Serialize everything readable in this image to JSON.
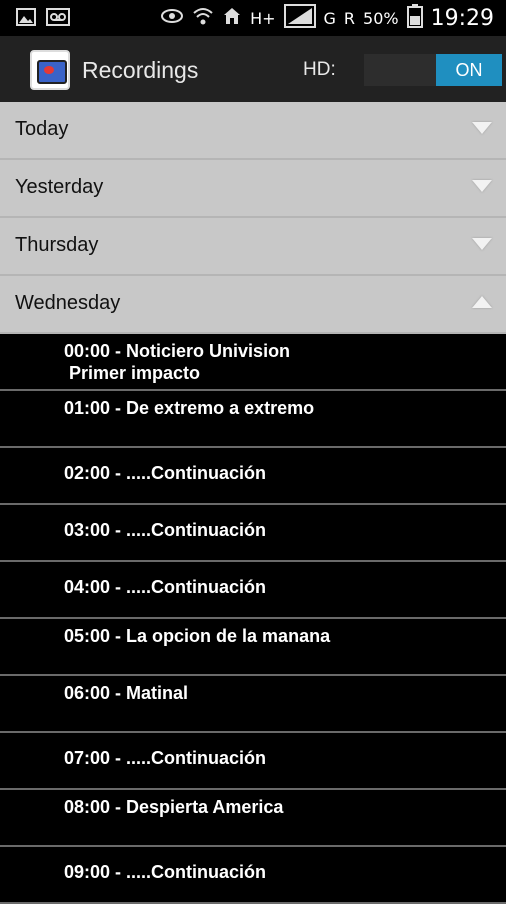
{
  "statusbar": {
    "network": "H+",
    "carrier": "G",
    "roaming": "R",
    "battery": "50%",
    "time": "19:29"
  },
  "actionbar": {
    "title": "Recordings",
    "hd_label": "HD:",
    "toggle_on": "ON"
  },
  "days": [
    {
      "label": "Today",
      "expanded": false
    },
    {
      "label": "Yesterday",
      "expanded": false
    },
    {
      "label": "Thursday",
      "expanded": false
    },
    {
      "label": "Wednesday",
      "expanded": true
    }
  ],
  "recordings": [
    {
      "text": "00:00 - Noticiero Univision\n Primer impacto"
    },
    {
      "text": "01:00 - De extremo a extremo"
    },
    {
      "text": "02:00 - .....Continuación"
    },
    {
      "text": "03:00 - .....Continuación"
    },
    {
      "text": "04:00 - .....Continuación"
    },
    {
      "text": "05:00 - La opcion de la manana"
    },
    {
      "text": "06:00 - Matinal"
    },
    {
      "text": "07:00 - .....Continuación"
    },
    {
      "text": "08:00 - Despierta America"
    },
    {
      "text": "09:00 - .....Continuación"
    }
  ],
  "colors": {
    "toggle_on": "#1f8fc0",
    "section_bg": "#c8c8c8",
    "list_bg": "#000000"
  }
}
